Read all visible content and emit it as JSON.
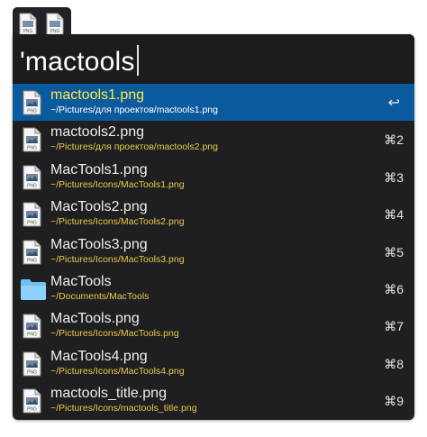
{
  "tab_strip": {
    "icons": [
      {
        "icon": "png-file-icon",
        "label": "PNG"
      },
      {
        "icon": "png-file-icon",
        "label": "PNG"
      }
    ]
  },
  "search": {
    "query": "'mactools"
  },
  "results": [
    {
      "title": "mactools1.png",
      "path": "~/Pictures/для проектов/mactools1.png",
      "shortcut": "↩",
      "icon": "png-file-icon",
      "icon_label": "PNG",
      "selected": true
    },
    {
      "title": "mactools2.png",
      "path": "~/Pictures/для проектов/mactools2.png",
      "shortcut": "⌘2",
      "icon": "png-file-icon",
      "icon_label": "PNG",
      "selected": false
    },
    {
      "title": "MacTools1.png",
      "path": "~/Pictures/Icons/MacTools1.png",
      "shortcut": "⌘3",
      "icon": "png-file-icon",
      "icon_label": "PNG",
      "selected": false
    },
    {
      "title": "MacTools2.png",
      "path": "~/Pictures/Icons/MacTools2.png",
      "shortcut": "⌘4",
      "icon": "png-file-icon",
      "icon_label": "PNG",
      "selected": false
    },
    {
      "title": "MacTools3.png",
      "path": "~/Pictures/Icons/MacTools3.png",
      "shortcut": "⌘5",
      "icon": "png-file-icon",
      "icon_label": "PNG",
      "selected": false
    },
    {
      "title": "MacTools",
      "path": "~/Documents/MacTools",
      "shortcut": "⌘6",
      "icon": "folder-icon",
      "icon_label": "",
      "selected": false
    },
    {
      "title": "MacTools.png",
      "path": "~/Pictures/Icons/MacTools.png",
      "shortcut": "⌘7",
      "icon": "png-file-icon",
      "icon_label": "PNG",
      "selected": false
    },
    {
      "title": "MacTools4.png",
      "path": "~/Pictures/Icons/MacTools4.png",
      "shortcut": "⌘8",
      "icon": "png-file-icon",
      "icon_label": "PNG",
      "selected": false
    },
    {
      "title": "mactools_title.png",
      "path": "~/Pictures/Icons/mactools_title.png",
      "shortcut": "⌘9",
      "icon": "png-file-icon",
      "icon_label": "PNG",
      "selected": false
    }
  ],
  "colors": {
    "window_bg": "#1f1f21",
    "selection_bg": "#0c5a9e",
    "selected_title": "#ffec3d",
    "path_text": "#e8c84a"
  }
}
